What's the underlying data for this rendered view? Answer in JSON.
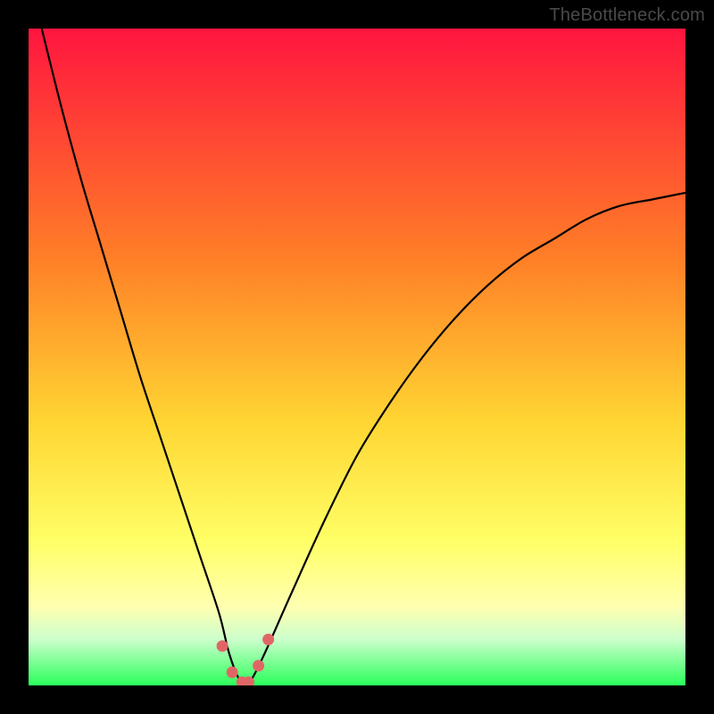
{
  "watermark": "TheBottleneck.com",
  "colors": {
    "gradient_top": "#ff153f",
    "gradient_mid_upper": "#ff7f27",
    "gradient_mid": "#ffd633",
    "gradient_yellow": "#ffff66",
    "gradient_pale": "#ffffcc",
    "gradient_green": "#2aff5a",
    "curve": "#000000",
    "marker_fill": "#e06666",
    "marker_stroke": "#c94f4f",
    "frame": "#000000"
  },
  "chart_data": {
    "type": "line",
    "title": "",
    "xlabel": "",
    "ylabel": "",
    "xlim": [
      0,
      100
    ],
    "ylim": [
      0,
      100
    ],
    "annotations": [
      "TheBottleneck.com"
    ],
    "series": [
      {
        "name": "bottleneck-curve",
        "x": [
          2,
          5,
          8,
          11,
          14,
          17,
          20,
          23,
          26,
          29,
          30.5,
          32,
          33,
          34,
          36,
          40,
          45,
          50,
          55,
          60,
          65,
          70,
          75,
          80,
          85,
          90,
          95,
          100
        ],
        "y": [
          100,
          88,
          77,
          67,
          57,
          47,
          38,
          29,
          20,
          11,
          5,
          1,
          0,
          1,
          5,
          14,
          25,
          35,
          43,
          50,
          56,
          61,
          65,
          68,
          71,
          73,
          74,
          75
        ]
      }
    ],
    "markers": {
      "name": "highlight-points",
      "x": [
        29.5,
        31,
        32.5,
        33.5,
        35,
        36.5
      ],
      "y": [
        6,
        2,
        0.5,
        0.5,
        3,
        7
      ]
    },
    "gradient_bands_pct_from_top": [
      {
        "stop": 0,
        "color": "#ff153f"
      },
      {
        "stop": 35,
        "color": "#ff7f27"
      },
      {
        "stop": 60,
        "color": "#ffd633"
      },
      {
        "stop": 78,
        "color": "#ffff66"
      },
      {
        "stop": 88,
        "color": "#ffffb0"
      },
      {
        "stop": 93,
        "color": "#ccffcc"
      },
      {
        "stop": 100,
        "color": "#2aff5a"
      }
    ]
  }
}
